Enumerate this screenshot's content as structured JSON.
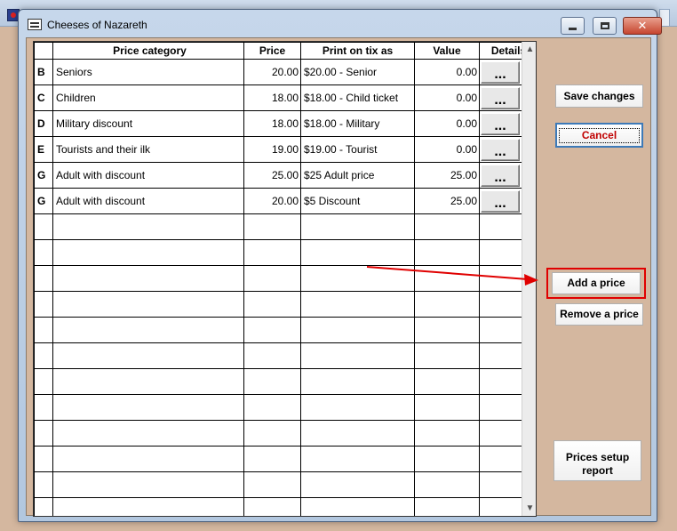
{
  "window": {
    "title": "Cheeses of Nazareth",
    "close_glyph": "✕"
  },
  "grid": {
    "headers": {
      "code": "",
      "category": "Price category",
      "price": "Price",
      "tix": "Print on tix as",
      "value": "Value",
      "details": "Details"
    },
    "details_glyph": "...",
    "rows": [
      {
        "code": "B",
        "category": "Seniors",
        "price": "20.00",
        "tix": "$20.00 - Senior",
        "value": "0.00"
      },
      {
        "code": "C",
        "category": "Children",
        "price": "18.00",
        "tix": "$18.00 - Child ticket",
        "value": "0.00"
      },
      {
        "code": "D",
        "category": "Military discount",
        "price": "18.00",
        "tix": "$18.00 - Military",
        "value": "0.00"
      },
      {
        "code": "E",
        "category": "Tourists and their ilk",
        "price": "19.00",
        "tix": "$19.00 - Tourist",
        "value": "0.00"
      },
      {
        "code": "G",
        "category": "Adult with discount",
        "price": "25.00",
        "tix": "$25 Adult price",
        "value": "25.00"
      },
      {
        "code": "G",
        "category": "Adult with discount",
        "price": "20.00",
        "tix": "$5 Discount",
        "value": "25.00"
      }
    ],
    "empty_rows": 12
  },
  "buttons": {
    "save_changes": "Save changes",
    "cancel": "Cancel",
    "add_price": "Add a price",
    "remove_price": "Remove a price",
    "prices_report_line1": "Prices setup",
    "prices_report_line2": "report"
  },
  "colors": {
    "annotation_red": "#e00000",
    "client_bg": "#d4b79f"
  }
}
